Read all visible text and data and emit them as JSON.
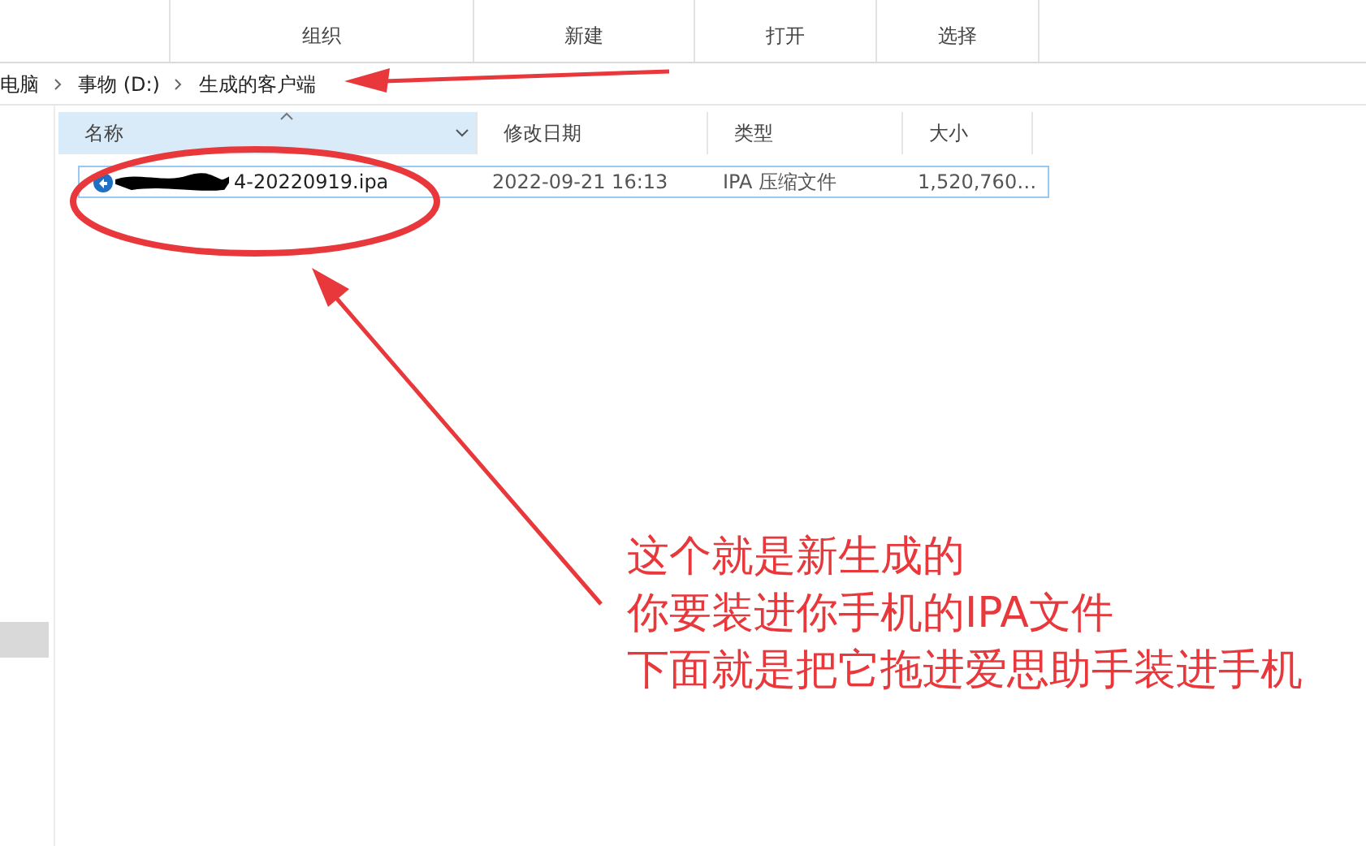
{
  "ribbon": {
    "groups": [
      {
        "label": "组织"
      },
      {
        "label": "新建"
      },
      {
        "label": "打开"
      },
      {
        "label": "选择"
      }
    ]
  },
  "breadcrumb": [
    "电脑",
    "事物 (D:)",
    "生成的客户端"
  ],
  "sidebar": {
    "items": [
      {
        "selected": true
      }
    ]
  },
  "columns": [
    {
      "label": "名称",
      "sorted": true
    },
    {
      "label": "修改日期",
      "sorted": false
    },
    {
      "label": "类型",
      "sorted": false
    },
    {
      "label": "大小",
      "sorted": false
    }
  ],
  "files": [
    {
      "name": "4-20220919.ipa",
      "modified": "2022-09-21 16:13",
      "type": "IPA 压缩文件",
      "size": "1,520,760…",
      "selected": true,
      "redacted": true
    }
  ],
  "annotation": {
    "lines": [
      "这个就是新生成的",
      "你要装进你手机的IPA文件",
      "下面就是把它拖进爱思助手装进手机"
    ]
  }
}
